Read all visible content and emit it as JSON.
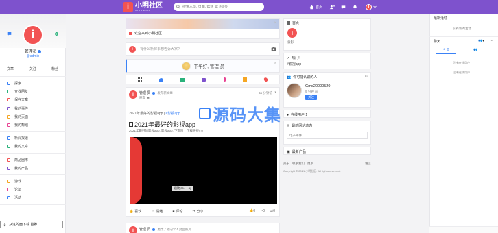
{
  "brand": {
    "logo_char": "i",
    "name": "小明社区",
    "sub": "XIAOMING"
  },
  "search": {
    "placeholder": "搜索人员, 页面, 帮组 或 #标签"
  },
  "topnav": {
    "home": "首页",
    "friends": "好友",
    "accent": "#7e52cd"
  },
  "user": {
    "name": "管理员",
    "handle": "@admin",
    "avatar_char": "i"
  },
  "profile_stats": [
    "文章",
    "关注",
    "粉丝"
  ],
  "menu_groups": [
    [
      {
        "icon": "home-icon",
        "label": "探索"
      },
      {
        "icon": "users-icon",
        "label": "查找朋友"
      },
      {
        "icon": "bookmark-icon",
        "label": "保存文章"
      },
      {
        "icon": "calendar-icon",
        "label": "我的事件"
      },
      {
        "icon": "chart-icon",
        "label": "我的页面"
      },
      {
        "icon": "group-icon",
        "label": "我的帮组"
      }
    ],
    [
      {
        "icon": "news-icon",
        "label": "新闻报道"
      },
      {
        "icon": "doc-icon",
        "label": "我的文章"
      }
    ],
    [
      {
        "icon": "store-icon",
        "label": "商品圈市"
      },
      {
        "icon": "bag-icon",
        "label": "我的产品"
      }
    ],
    [
      {
        "icon": "game-icon",
        "label": "游戏"
      },
      {
        "icon": "forum-icon",
        "label": "论坛"
      },
      {
        "icon": "flag-icon",
        "label": "活动"
      }
    ]
  ],
  "download_banner": "从这的面下载 首推",
  "welcome": {
    "text": "欢迎来到小明社区！"
  },
  "composer": {
    "placeholder": "有什么新鲜事想告诉大家?"
  },
  "greeting": {
    "text": "下午好, 管理 员"
  },
  "post1": {
    "author": "管理 员",
    "action": "发布新文章",
    "time": "11 分钟前",
    "visibility": "朋友",
    "subtitle_text": "2021年最好的影视app |",
    "subtitle_tag": "#影视app",
    "title": "2021年最好的影视app",
    "excerpt": "2021年最好的影视app, 影视app, 下面附上下载链接! ! !",
    "video_label": "剧院(00:) + 4)",
    "like": "喜欢",
    "emotion": "情绪",
    "comment": "评论",
    "share": "分享",
    "count_likes": "0",
    "count_comments": "0",
    "count_shares": "0"
  },
  "post2": {
    "author": "管理 员",
    "action": "更改了他的个人封面照片"
  },
  "right": {
    "album_title": "首页",
    "album_item": "云影",
    "trending_title": "热门!",
    "trending_tag": "#影视app",
    "suggest_title": "你可能认识的人",
    "suggest_name": "Gmd20000520",
    "suggest_meta": "9 分钟 前",
    "follow_btn": "关注",
    "online_title": "在线用户 1",
    "newsletter_title": "最新网站动态",
    "newsletter_placeholder": "电子邮件",
    "popular_title": "最新产品",
    "footer_links": [
      "关于",
      "联系我们",
      "更多"
    ],
    "footer_lang": "语言",
    "copyright": "Copyright © 2021 小明社区. All rights reserved."
  },
  "sidepanel": {
    "activity_title": "最新活动",
    "activity_empty": "没有新的活动",
    "chat_title": "聊天",
    "chat_tab_count": "0",
    "chat_empty_1": "没有在线用户",
    "chat_empty_2": "没有在线用户"
  },
  "watermark": "源码大集"
}
